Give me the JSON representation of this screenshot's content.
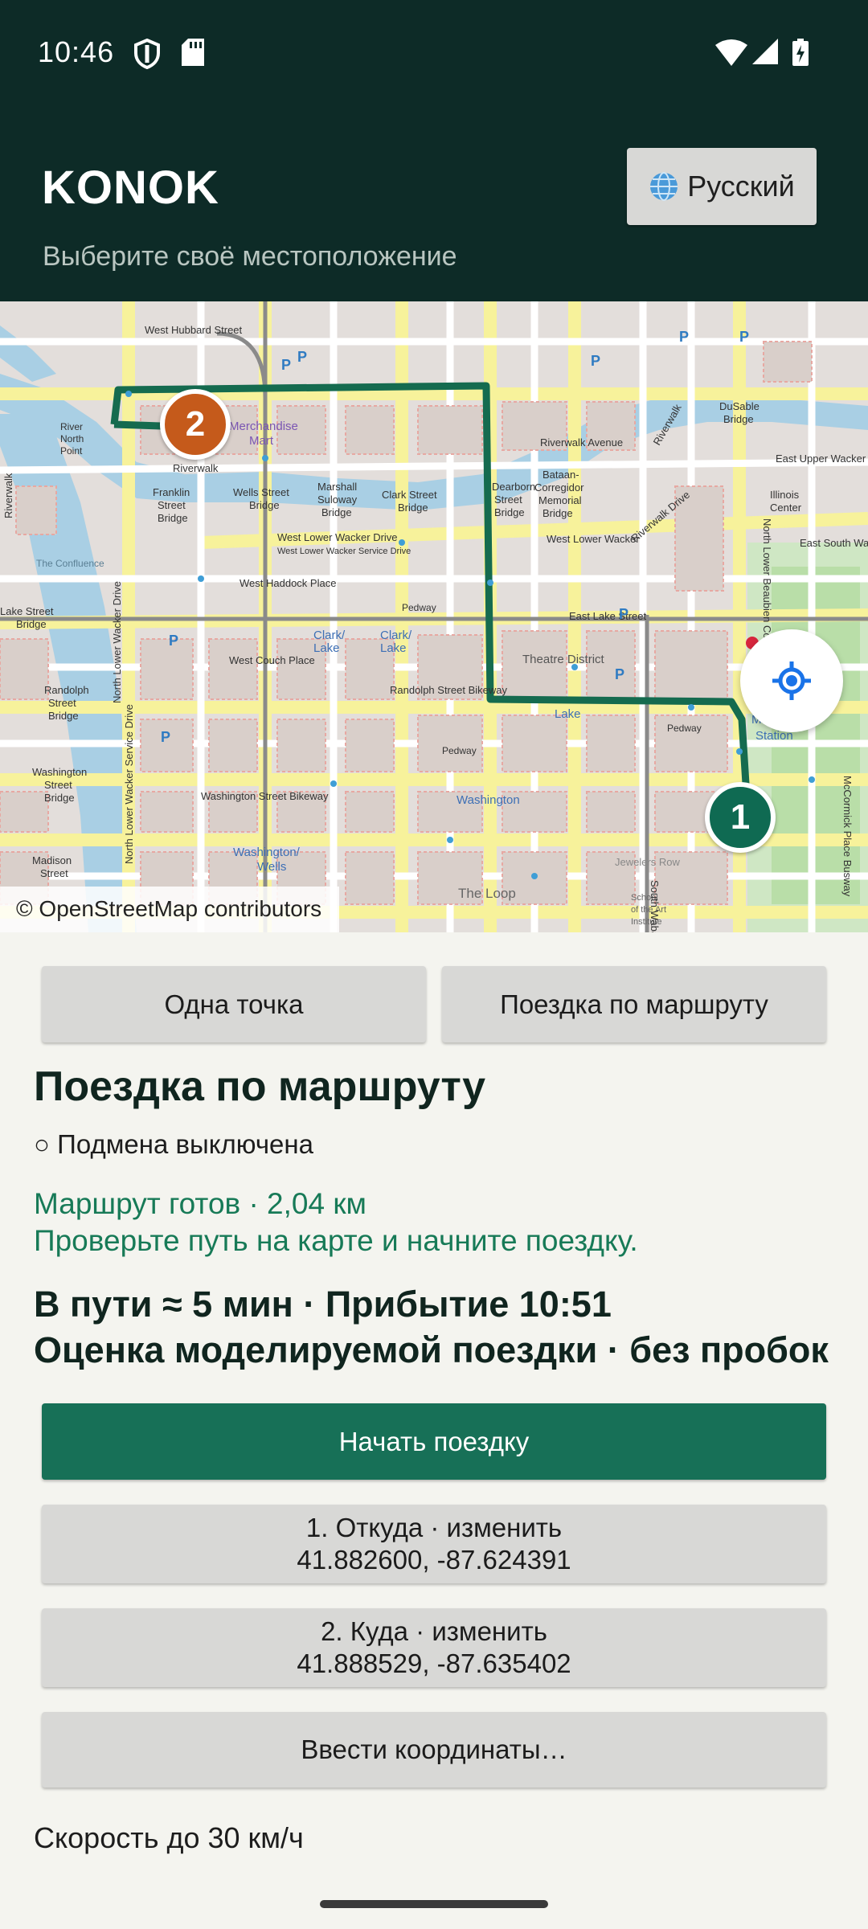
{
  "status_bar": {
    "time": "10:46",
    "icons": [
      "shield-icon",
      "sd-card-icon",
      "wifi-icon",
      "signal-icon",
      "battery-charging-icon"
    ]
  },
  "header": {
    "title": "KONOK",
    "subtitle": "Выберите своё местоположение",
    "language_button": "Русский",
    "language_icon": "globe-icon"
  },
  "map": {
    "attribution": "© OpenStreetMap contributors",
    "locate_icon": "crosshair-icon",
    "markers": [
      {
        "label": "2",
        "color": "#c55a1b"
      },
      {
        "label": "1",
        "color": "#0f6a52"
      }
    ],
    "route_color": "#156b4f",
    "labels": [
      "West Hubbard Street",
      "Merchandise Mart",
      "Riverwalk",
      "Franklin Street Bridge",
      "Wells Street Bridge",
      "Marshall Suloway Bridge",
      "Clark Street Bridge",
      "Dearborn Street Bridge",
      "Bataan-Corregidor Memorial Bridge",
      "Riverwalk Avenue",
      "Riverwalk Drive",
      "DuSable Bridge",
      "East Upper Wacker",
      "Illinois Center",
      "East South Wacker",
      "West Lower Wacker Drive",
      "West Lower Wacker Service Drive",
      "West Haddock Place",
      "Pedway",
      "Lake Street Bridge",
      "Lake Street",
      "East Lake Street",
      "Clark/Lake",
      "Theatre District",
      "Lake",
      "Randolph Street Bridge",
      "Randolph Street Bikeway",
      "West Couch Place",
      "Millennium Station",
      "Washington Street Bridge",
      "Washington Street Bikeway",
      "Washington",
      "Washington/Wells",
      "Madison Street",
      "The Loop",
      "Jewelers Row",
      "School of the Art Institute",
      "The Confluence",
      "River North Point",
      "North Lower Wacker Drive",
      "North Lower Wacker Service Drive",
      "North Lower Beaubien Court",
      "McCormick Place Busway",
      "Pedway",
      "South Wabash"
    ]
  },
  "mode_tabs": {
    "single_point": "Одна точка",
    "route_trip": "Поездка по маршруту"
  },
  "section": {
    "title": "Поездка по маршруту",
    "spoof_status": "○ Подмена выключена",
    "route_ready": "Маршрут готов · 2,04 км",
    "route_hint": "Проверьте путь на карте и начните поездку.",
    "eta": "В пути ≈ 5 мин · Прибытие 10:51",
    "estimate": "Оценка моделируемой поездки · без пробок"
  },
  "buttons": {
    "start": "Начать поездку",
    "from_label": "1. Откуда · изменить",
    "from_coords": "41.882600, -87.624391",
    "to_label": "2. Куда · изменить",
    "to_coords": "41.888529, -87.635402",
    "enter_coords": "Ввести координаты…"
  },
  "speed_text": "Скорость до 30 км/ч",
  "colors": {
    "header_bg": "#0d2b27",
    "accent": "#177057",
    "route_text": "#177a57",
    "page_bg": "#f4f4ef"
  }
}
